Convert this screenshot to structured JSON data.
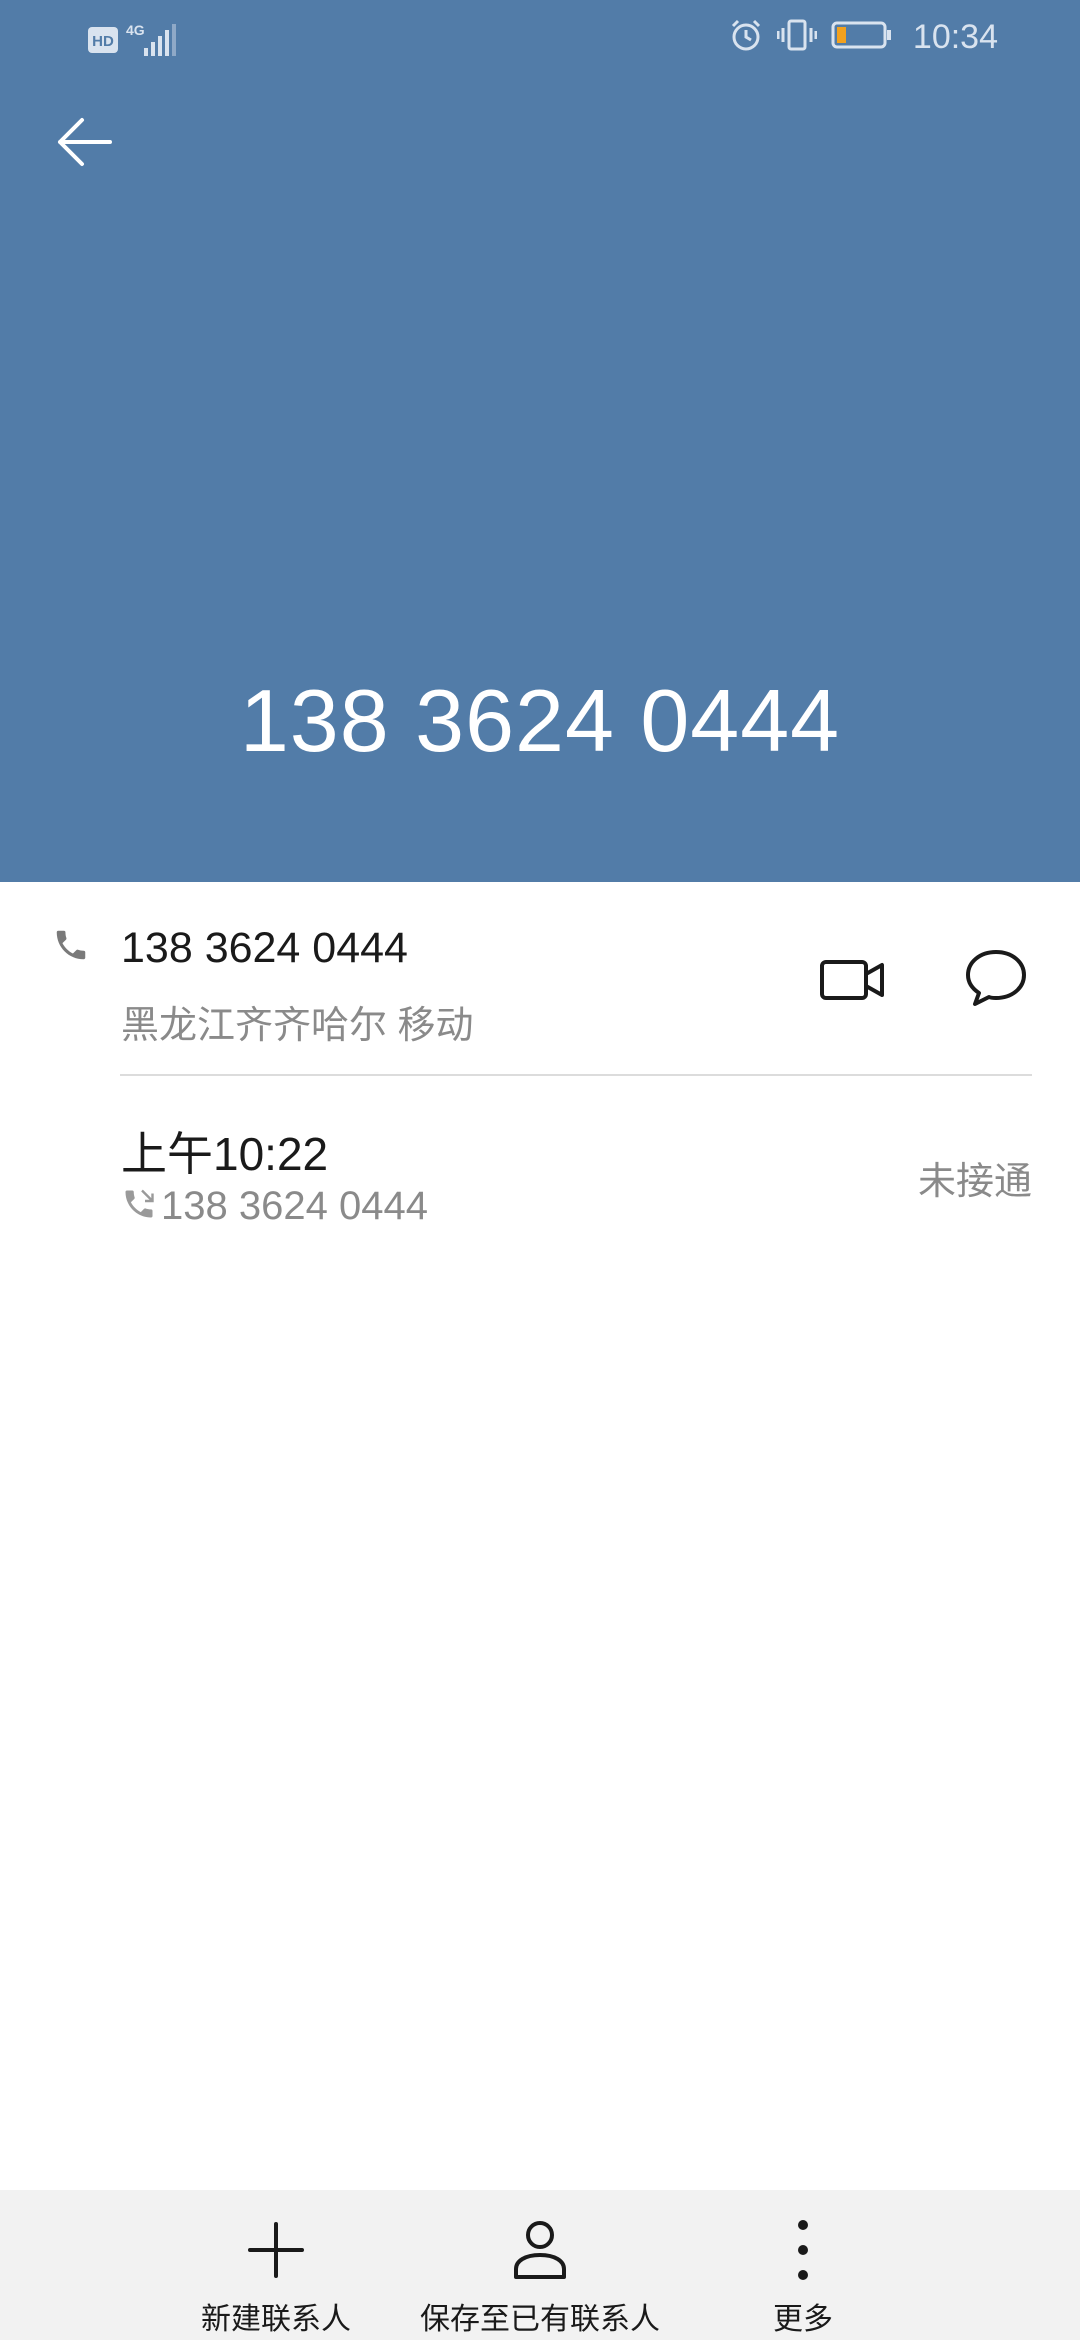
{
  "status_bar": {
    "hd_badge": "HD",
    "network": "4G",
    "time": "10:34",
    "icons": [
      "hd-icon",
      "signal-icon",
      "alarm-icon",
      "vibrate-icon",
      "battery-icon"
    ]
  },
  "header": {
    "back_icon": "arrow-left-icon",
    "display_number": "138 3624 0444",
    "background_color": "#527ca8"
  },
  "number_row": {
    "icon": "phone-icon",
    "number": "138 3624 0444",
    "location": "黑龙江齐齐哈尔 移动",
    "actions": [
      "video-call-icon",
      "message-icon"
    ]
  },
  "call_history": [
    {
      "time": "上午10:22",
      "icon": "missed-call-icon",
      "number": "138 3624 0444",
      "status": "未接通"
    }
  ],
  "bottom_bar": {
    "items": [
      {
        "icon": "plus-icon",
        "label": "新建联系人"
      },
      {
        "icon": "person-icon",
        "label": "保存至已有联系人"
      },
      {
        "icon": "more-vertical-icon",
        "label": "更多"
      }
    ]
  }
}
